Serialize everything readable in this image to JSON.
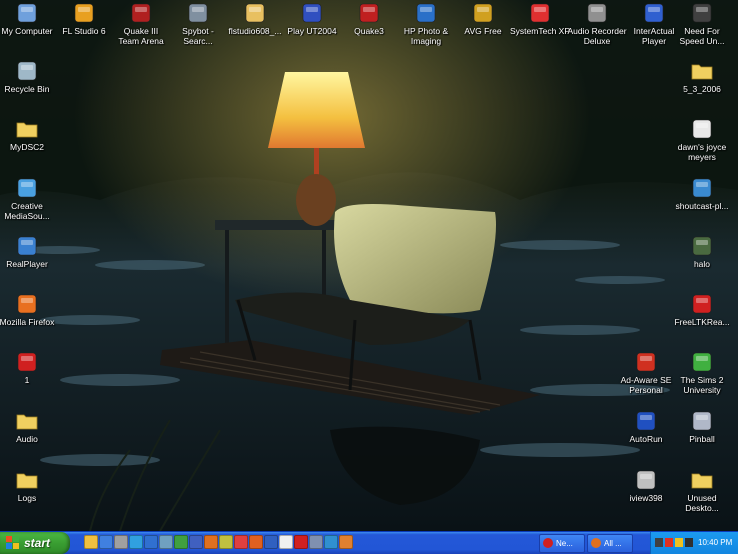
{
  "desktop": {
    "icons": [
      {
        "label": "My Computer",
        "name": "my-computer-icon",
        "color": "#6fa0dc"
      },
      {
        "label": "FL Studio 6",
        "name": "fl-studio-icon",
        "color": "#e8a020"
      },
      {
        "label": "Quake III\nTeam Arena",
        "name": "quake-team-arena-icon",
        "color": "#b02020"
      },
      {
        "label": "Spybot -\nSearc...",
        "name": "spybot-icon",
        "color": "#8090a0"
      },
      {
        "label": "flstudio608_...",
        "name": "flstudio-installer-icon",
        "color": "#e8c060"
      },
      {
        "label": "Play UT2004",
        "name": "ut2004-icon",
        "color": "#3050c0"
      },
      {
        "label": "Quake3",
        "name": "quake3-icon",
        "color": "#c02020"
      },
      {
        "label": "HP Photo &\nImaging",
        "name": "hp-photo-icon",
        "color": "#2a70c8"
      },
      {
        "label": "AVG Free",
        "name": "avg-free-icon",
        "color": "#d0a020"
      },
      {
        "label": "SystemTech XP",
        "name": "systemtech-icon",
        "color": "#e03030"
      },
      {
        "label": "Audio Recorder\nDeluxe",
        "name": "audio-recorder-icon",
        "color": "#909090"
      },
      {
        "label": "InterActual\nPlayer",
        "name": "interactual-player-icon",
        "color": "#3060d0"
      },
      {
        "label": "Need For\nSpeed Un...",
        "name": "need-for-speed-icon",
        "color": "#404040"
      },
      {
        "label": "Recycle Bin",
        "name": "recycle-bin-icon",
        "color": "#9fb8c8"
      },
      {
        "label": "MyDSC2",
        "name": "mydsc2-folder-icon",
        "color": "#f0d060"
      },
      {
        "label": "Creative\nMediaSou...",
        "name": "creative-mediasource-icon",
        "color": "#4aa0e0"
      },
      {
        "label": "RealPlayer",
        "name": "realplayer-icon",
        "color": "#3a80d0"
      },
      {
        "label": "Mozilla Firefox",
        "name": "firefox-icon",
        "color": "#e87020"
      },
      {
        "label": "1",
        "name": "shortcut-1-icon",
        "color": "#d02020"
      },
      {
        "label": "Audio",
        "name": "audio-folder-icon",
        "color": "#f0d060"
      },
      {
        "label": "Logs",
        "name": "logs-folder-icon",
        "color": "#f0d060"
      },
      {
        "label": "5_3_2006",
        "name": "folder-5-3-2006-icon",
        "color": "#f0d060"
      },
      {
        "label": "dawn's joyce\nmeyers",
        "name": "dawns-joyce-meyers-icon",
        "color": "#e8e8e8"
      },
      {
        "label": "shoutcast-pl...",
        "name": "shoutcast-icon",
        "color": "#3a8ad0"
      },
      {
        "label": "halo",
        "name": "halo-icon",
        "color": "#4a6a40"
      },
      {
        "label": "FreeLTKRea...",
        "name": "pdf-document-icon",
        "color": "#d02020"
      },
      {
        "label": "Ad-Aware SE\nPersonal",
        "name": "ad-aware-icon",
        "color": "#d03020"
      },
      {
        "label": "The Sims 2\nUniversity",
        "name": "sims2-university-icon",
        "color": "#40b040"
      },
      {
        "label": "AutoRun",
        "name": "ea-autorun-icon",
        "color": "#2050c0"
      },
      {
        "label": "Pinball",
        "name": "pinball-icon",
        "color": "#b0b8c8"
      },
      {
        "label": "iview398",
        "name": "iview-icon",
        "color": "#c0c0c0"
      },
      {
        "label": "Unused\nDeskto...",
        "name": "unused-desktop-folder-icon",
        "color": "#f0d060"
      }
    ]
  },
  "taskbar": {
    "start_label": "start",
    "quicklaunch": [
      {
        "name": "ql-folder-icon",
        "color": "#f0c040"
      },
      {
        "name": "ql-ie-icon",
        "color": "#4080e0"
      },
      {
        "name": "ql-scanner-icon",
        "color": "#a0a0a0"
      },
      {
        "name": "ql-media-icon",
        "color": "#30a0e0"
      },
      {
        "name": "ql-realplayer-icon",
        "color": "#3070d0"
      },
      {
        "name": "ql-search-icon",
        "color": "#70a0c0"
      },
      {
        "name": "ql-messenger-icon",
        "color": "#40a040"
      },
      {
        "name": "ql-network-icon",
        "color": "#4060c0"
      },
      {
        "name": "ql-media-player-icon",
        "color": "#e07020"
      },
      {
        "name": "ql-music-icon",
        "color": "#c0c040"
      },
      {
        "name": "ql-app-icon",
        "color": "#e04040"
      },
      {
        "name": "ql-firefox-icon",
        "color": "#e06020"
      },
      {
        "name": "ql-help-icon",
        "color": "#3060c0"
      },
      {
        "name": "ql-mail-icon",
        "color": "#f0f0f0"
      },
      {
        "name": "ql-record-icon",
        "color": "#d02020"
      },
      {
        "name": "ql-disk-icon",
        "color": "#8090b0"
      },
      {
        "name": "ql-world-icon",
        "color": "#3090d0"
      },
      {
        "name": "ql-orange-icon",
        "color": "#e08030"
      }
    ],
    "tasks": [
      {
        "label": "Ne...",
        "name": "task-button-ne",
        "color": "#d02020"
      },
      {
        "label": "All ...",
        "name": "task-button-all",
        "color": "#e07020"
      }
    ],
    "tray_icons": [
      {
        "name": "tray-network-icon",
        "color": "#404040"
      },
      {
        "name": "tray-security-icon",
        "color": "#e03020"
      },
      {
        "name": "tray-volume-icon",
        "color": "#f0c020"
      },
      {
        "name": "tray-monitor-icon",
        "color": "#303030"
      }
    ],
    "clock": "10:40 PM"
  }
}
